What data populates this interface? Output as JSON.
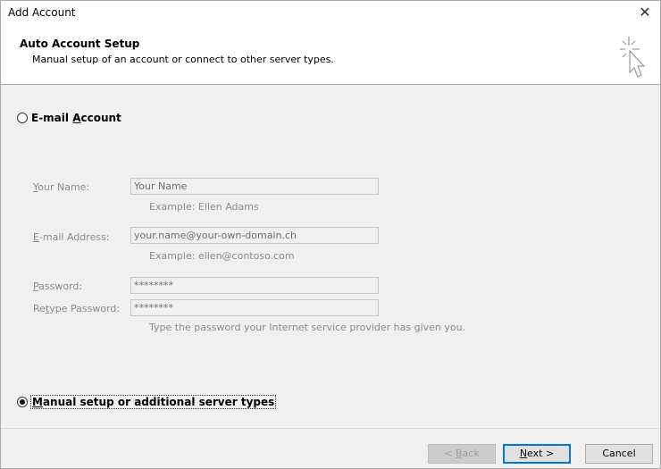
{
  "window": {
    "title": "Add Account",
    "close_glyph": "✕"
  },
  "header": {
    "title": "Auto Account Setup",
    "subtitle": "Manual setup of an account or connect to other server types.",
    "icon": "wizard-cursor-icon"
  },
  "options": {
    "email_account": {
      "label_pre": "E-mail ",
      "label_ul": "A",
      "label_post": "ccount",
      "selected": false
    },
    "manual_setup": {
      "label_pre": "",
      "label_ul": "M",
      "label_post": "anual setup or additional server types",
      "selected": true
    }
  },
  "form": {
    "your_name": {
      "label_ul": "Y",
      "label_post": "our Name:",
      "value": "Your Name",
      "hint": "Example: Ellen Adams"
    },
    "email_address": {
      "label_ul": "E",
      "label_post": "-mail Address:",
      "value": "your.name@your-own-domain.ch",
      "hint": "Example: ellen@contoso.com"
    },
    "password": {
      "label_ul": "P",
      "label_post": "assword:",
      "value": "********"
    },
    "retype_password": {
      "label_pre": "Re",
      "label_ul": "t",
      "label_post": "ype Password:",
      "value": "********",
      "hint": "Type the password your Internet service provider has given you."
    }
  },
  "buttons": {
    "back": {
      "label_pre": "< ",
      "label_ul": "B",
      "label_post": "ack",
      "enabled": false
    },
    "next": {
      "label_pre": "",
      "label_ul": "N",
      "label_post": "ext >",
      "enabled": true
    },
    "cancel": {
      "label": "Cancel",
      "enabled": true
    }
  }
}
